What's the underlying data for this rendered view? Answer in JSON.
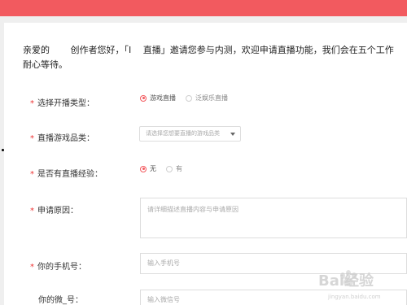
{
  "intro": {
    "line1": "亲爱的　　 创作者您好，「I　 直播」邀请您参与内测，欢迎申请直播功能，我们会在五个工作",
    "line2": "耐心等待。"
  },
  "form": {
    "live_type": {
      "label": "选择开播类型：",
      "options": [
        "游戏直播",
        "泛娱乐直播"
      ],
      "selected": "游戏直播"
    },
    "game_category": {
      "label": "直播游戏品类：",
      "placeholder": "请选择您想要直播的游戏品类"
    },
    "experience": {
      "label": "是否有直播经验：",
      "options": [
        "无",
        "有"
      ],
      "selected": "无"
    },
    "reason": {
      "label": "申请原因：",
      "placeholder": "请详细描述直播内容与申请原因"
    },
    "phone": {
      "label": "你的手机号：",
      "placeholder": "输入手机号"
    },
    "wechat": {
      "label": "你的微_号：",
      "placeholder": "输入微信号"
    }
  },
  "watermark": {
    "text": "Bai经验",
    "sub": "jingyan.baidu.com"
  },
  "colors": {
    "accent": "#f25a5f",
    "required": "#ee3333"
  }
}
